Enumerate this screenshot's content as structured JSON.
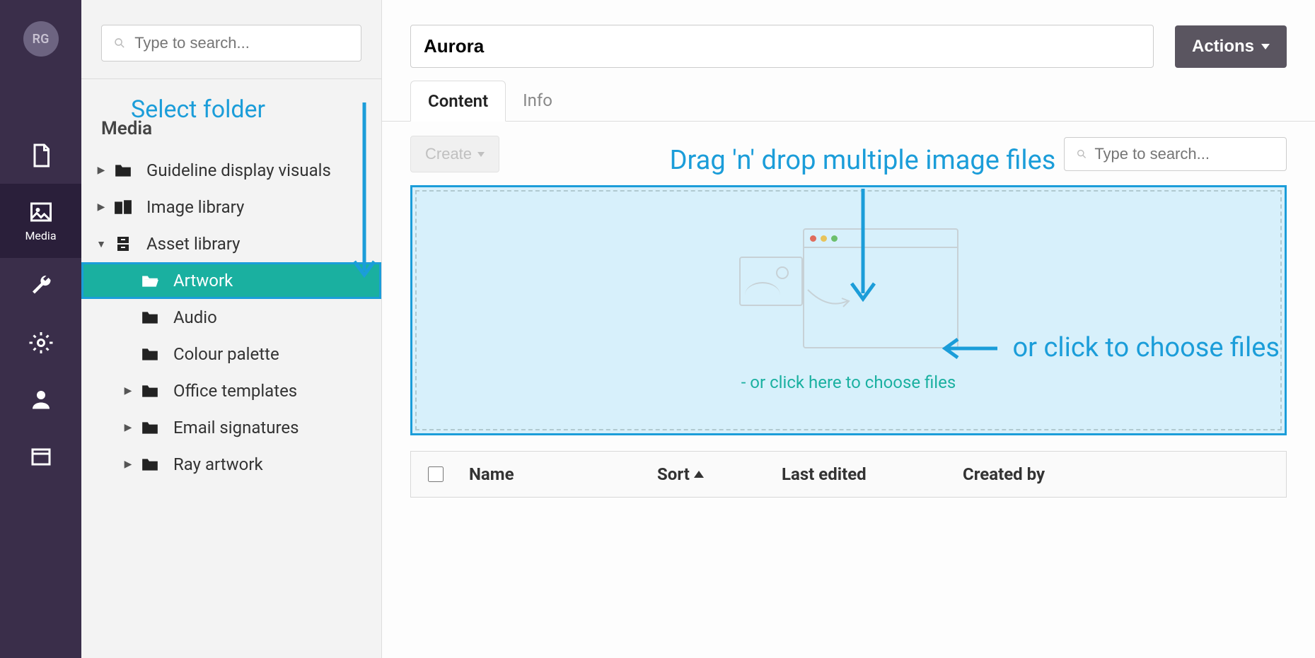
{
  "accent_color": "#1ab0a0",
  "annotation_color": "#1b9dd9",
  "rail": {
    "avatar": "RG",
    "active_label": "Media"
  },
  "sidebar": {
    "search_placeholder": "Type to search...",
    "heading": "Media",
    "items": [
      {
        "label": "Guideline display visuals",
        "icon": "folder",
        "expandable": true,
        "expanded": false,
        "depth": 0
      },
      {
        "label": "Image library",
        "icon": "devices",
        "expandable": true,
        "expanded": false,
        "depth": 0
      },
      {
        "label": "Asset library",
        "icon": "cabinet",
        "expandable": true,
        "expanded": true,
        "depth": 0
      },
      {
        "label": "Artwork",
        "icon": "folder-open",
        "expandable": false,
        "depth": 1,
        "selected": true,
        "highlighted": true
      },
      {
        "label": "Audio",
        "icon": "folder",
        "expandable": false,
        "depth": 1
      },
      {
        "label": "Colour palette",
        "icon": "folder",
        "expandable": false,
        "depth": 1
      },
      {
        "label": "Office templates",
        "icon": "folder",
        "expandable": true,
        "expanded": false,
        "depth": 1
      },
      {
        "label": "Email signatures",
        "icon": "folder",
        "expandable": true,
        "expanded": false,
        "depth": 1
      },
      {
        "label": "Ray artwork",
        "icon": "folder",
        "expandable": true,
        "expanded": false,
        "depth": 1
      }
    ]
  },
  "annotations": {
    "select_folder": "Select folder",
    "drag_drop": "Drag 'n' drop multiple image files",
    "or_click": "or click to choose files"
  },
  "main": {
    "title_value": "Aurora",
    "actions_label": "Actions",
    "tabs": [
      {
        "label": "Content",
        "active": true
      },
      {
        "label": "Info",
        "active": false
      }
    ],
    "create_label": "Create",
    "content_search_placeholder": "Type to search...",
    "dropzone_text": "- or click here to choose files",
    "columns": {
      "name": "Name",
      "sort": "Sort",
      "last_edited": "Last edited",
      "created_by": "Created by"
    }
  }
}
